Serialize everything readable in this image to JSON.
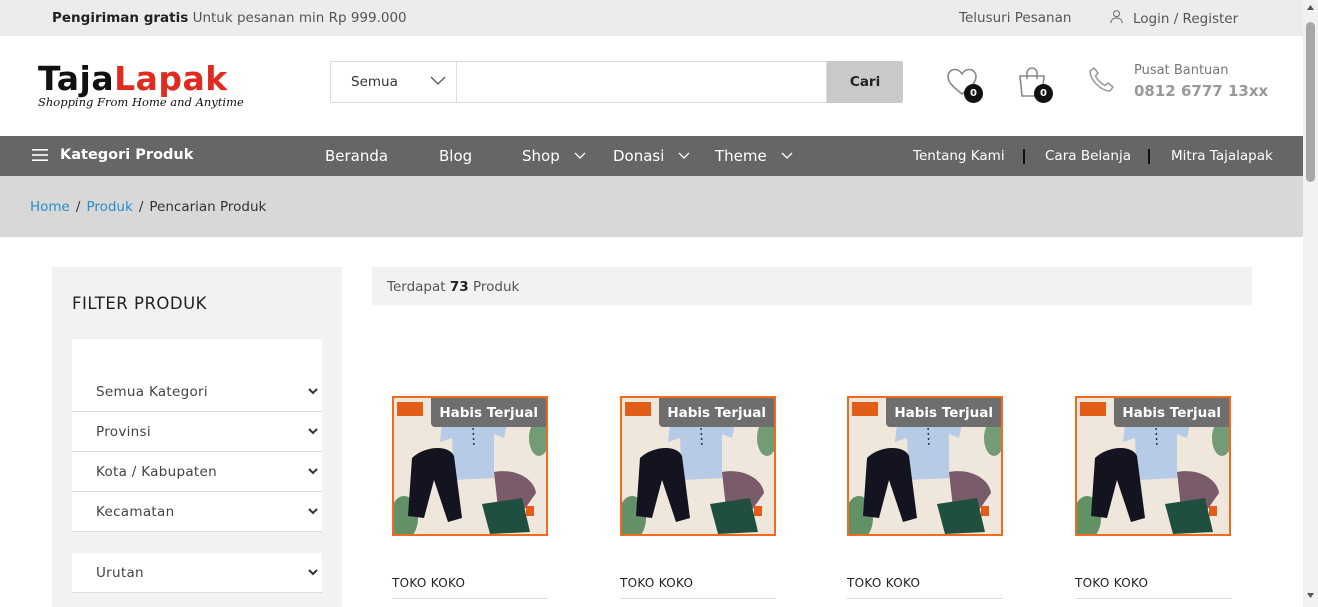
{
  "topbar": {
    "ship_bold": "Pengiriman gratis",
    "ship_text": "Untuk pesanan min Rp 999.000",
    "track": "Telusuri Pesanan",
    "login": "Login / Register"
  },
  "logo": {
    "part1": "Taja",
    "part2": "Lapak",
    "tagline": "Shopping From Home and Anytime"
  },
  "search": {
    "category": "Semua",
    "value": "",
    "button": "Cari"
  },
  "wishlist": {
    "count": "0"
  },
  "cart": {
    "count": "0"
  },
  "help": {
    "label": "Pusat Bantuan",
    "phone": "0812 6777 13xx"
  },
  "nav": {
    "category": "Kategori Produk",
    "items": [
      "Beranda",
      "Blog",
      "Shop",
      "Donasi",
      "Theme"
    ],
    "right": [
      "Tentang Kami",
      "Cara Belanja",
      "Mitra Tajalapak"
    ]
  },
  "breadcrumb": {
    "home": "Home",
    "produk": "Produk",
    "current": "Pencarian Produk",
    "sep": "/"
  },
  "filter": {
    "title": "FILTER PRODUK",
    "selects": [
      "Semua Kategori",
      "Provinsi",
      "Kota / Kabupaten",
      "Kecamatan"
    ],
    "sort": "Urutan"
  },
  "results": {
    "prefix": "Terdapat",
    "count": "73",
    "suffix": "Produk"
  },
  "products": [
    {
      "badge": "Habis Terjual",
      "shop": "TOKO KOKO"
    },
    {
      "badge": "Habis Terjual",
      "shop": "TOKO KOKO"
    },
    {
      "badge": "Habis Terjual",
      "shop": "TOKO KOKO"
    },
    {
      "badge": "Habis Terjual",
      "shop": "TOKO KOKO"
    }
  ],
  "colors": {
    "accent": "#e02b20",
    "link": "#2a8fc9",
    "product_border": "#f26b1d",
    "nav_bg": "#666666"
  }
}
